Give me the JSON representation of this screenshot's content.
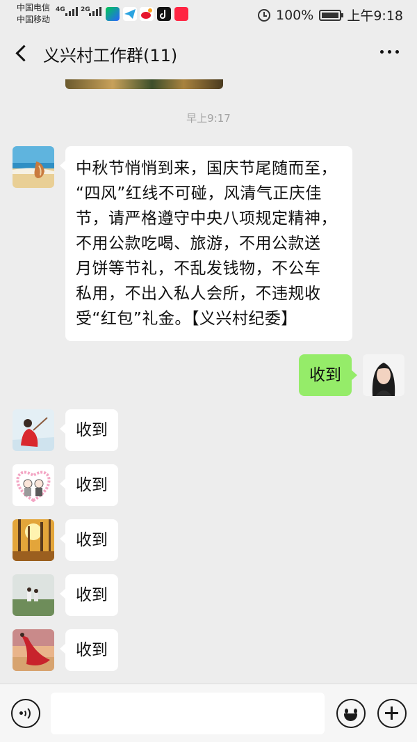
{
  "status_bar": {
    "carrier_1": "中国电信",
    "carrier_2": "中国移动",
    "net_1": "4G",
    "net_2": "2G",
    "battery": "100%",
    "battery_level": 1.0,
    "time": "上午9:18",
    "app_icons": [
      "iqiyi-icon",
      "telegram-icon",
      "sina-weibo-icon",
      "tiktok-icon",
      "xiaohongshu-icon"
    ]
  },
  "header": {
    "title": "义兴村工作群(11)"
  },
  "chat": {
    "timestamp": "早上9:17",
    "messages": [
      {
        "side": "left",
        "avatar": "avatar-beach-shell",
        "lines": [
          "中秋节悄悄到来，国庆节尾随而至，",
          "“四风”红线不可碰，风清气正庆佳",
          "节，请严格遵守中央八项规定精神，",
          "不用公款吃喝、旅游，不用公款送",
          "月饼等节礼，不乱发钱物，不公车",
          "私用，不出入私人会所，不违规收",
          "受“红包”礼金。【义兴村纪委】"
        ]
      },
      {
        "side": "right",
        "avatar": "avatar-self",
        "text": "收到"
      },
      {
        "side": "left",
        "avatar": "avatar-girl-red",
        "text": "收到"
      },
      {
        "side": "left",
        "avatar": "avatar-cartoon-couple",
        "text": "收到"
      },
      {
        "side": "left",
        "avatar": "avatar-autumn-forest",
        "text": "收到"
      },
      {
        "side": "left",
        "avatar": "avatar-couple-field",
        "text": "收到"
      },
      {
        "side": "left",
        "avatar": "avatar-red-dress-beach",
        "text": "收到"
      }
    ]
  },
  "input_bar": {
    "placeholder": ""
  },
  "colors": {
    "background": "#ededed",
    "bubble_self": "#95ec69",
    "bubble_other": "#ffffff"
  }
}
